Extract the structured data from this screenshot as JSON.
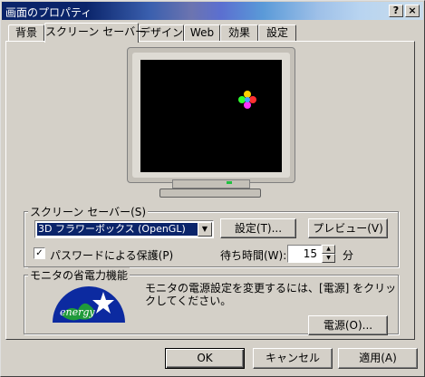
{
  "window": {
    "title": "画面のプロパティ",
    "help_button": "?",
    "close_button": "×"
  },
  "tabs": [
    {
      "label": "背景",
      "active": false
    },
    {
      "label": "スクリーン セーバー",
      "active": true
    },
    {
      "label": "デザイン",
      "active": false
    },
    {
      "label": "Web",
      "active": false
    },
    {
      "label": "効果",
      "active": false
    },
    {
      "label": "設定",
      "active": false
    }
  ],
  "screensaver": {
    "group_label": "スクリーン セーバー(S)",
    "selected": "3D フラワーボックス (OpenGL)",
    "settings_button": "設定(T)...",
    "preview_button": "プレビュー(V)",
    "password_label": "パスワードによる保護(P)",
    "password_checked": "✓",
    "wait_label": "待ち時間(W):",
    "wait_value": "15",
    "wait_unit": "分"
  },
  "power": {
    "group_label": "モニタの省電力機能",
    "description": "モニタの電源設定を変更するには、[電源] をクリックしてください。",
    "power_button": "電源(O)...",
    "logo_text": "energy"
  },
  "footer": {
    "ok": "OK",
    "cancel": "キャンセル",
    "apply": "適用(A)"
  },
  "colors": {
    "titlebar_start": "#0a246a",
    "selection": "#0a246a",
    "face": "#d4d0c8"
  }
}
